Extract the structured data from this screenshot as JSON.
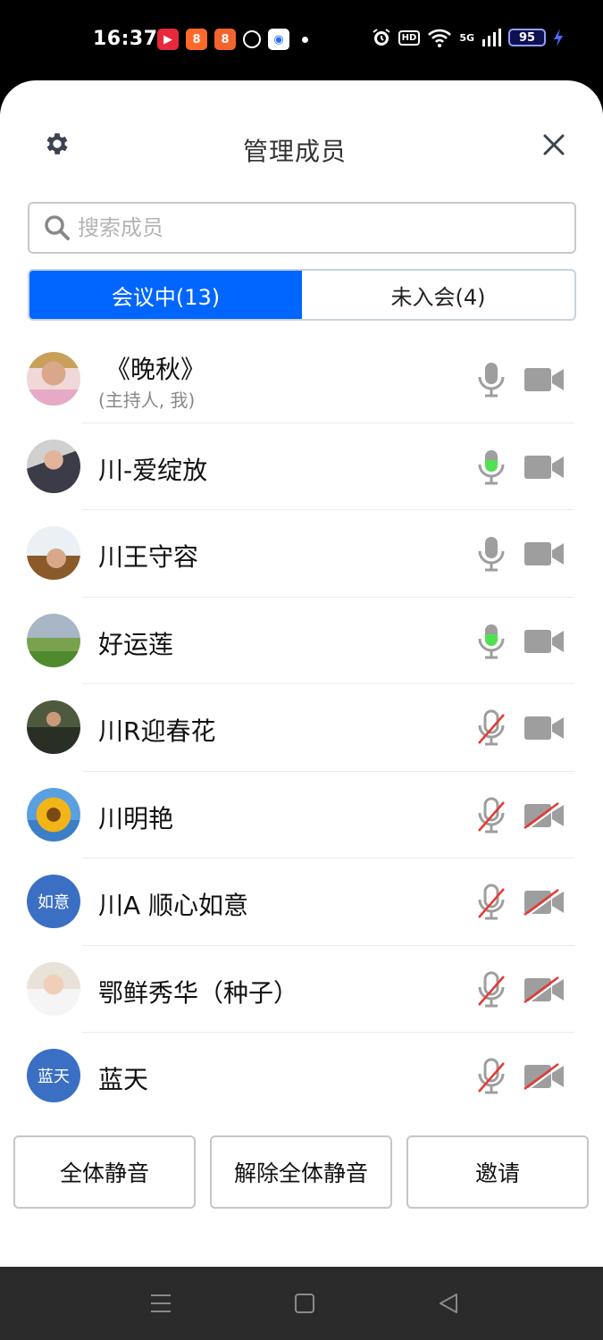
{
  "status_bar": {
    "time": "16:37",
    "battery": "95",
    "network": "5G"
  },
  "header": {
    "title": "管理成员"
  },
  "search": {
    "placeholder": "搜索成员"
  },
  "tabs": [
    {
      "label": "会议中(13)",
      "active": true
    },
    {
      "label": "未入会(4)",
      "active": false
    }
  ],
  "members": [
    {
      "name": "《晚秋》",
      "role": "(主持人, 我)",
      "avatar": "photo",
      "mic": "idle",
      "camera": "on"
    },
    {
      "name": "川-爱绽放",
      "role": "",
      "avatar": "photo",
      "mic": "speaking",
      "camera": "on"
    },
    {
      "name": "川王守容",
      "role": "",
      "avatar": "photo",
      "mic": "idle",
      "camera": "on"
    },
    {
      "name": "好运莲",
      "role": "",
      "avatar": "photo",
      "mic": "speaking",
      "camera": "on"
    },
    {
      "name": "川R迎春花",
      "role": "",
      "avatar": "photo",
      "mic": "muted",
      "camera": "on"
    },
    {
      "name": "川明艳",
      "role": "",
      "avatar": "photo",
      "mic": "muted",
      "camera": "off"
    },
    {
      "name": "川A 顺心如意",
      "role": "",
      "avatar_text": "如意",
      "mic": "muted",
      "camera": "off"
    },
    {
      "name": "鄂鲜秀华（种子）",
      "role": "",
      "avatar": "photo",
      "mic": "muted",
      "camera": "off"
    },
    {
      "name": "蓝天",
      "role": "",
      "avatar_text": "蓝天",
      "mic": "muted",
      "camera": "off"
    }
  ],
  "actions": {
    "mute_all": "全体静音",
    "unmute_all": "解除全体静音",
    "invite": "邀请"
  },
  "colors": {
    "accent": "#0066ff",
    "speaking": "#52e052",
    "muted_strike": "#e53935",
    "icon_gray": "#9e9e9e"
  }
}
